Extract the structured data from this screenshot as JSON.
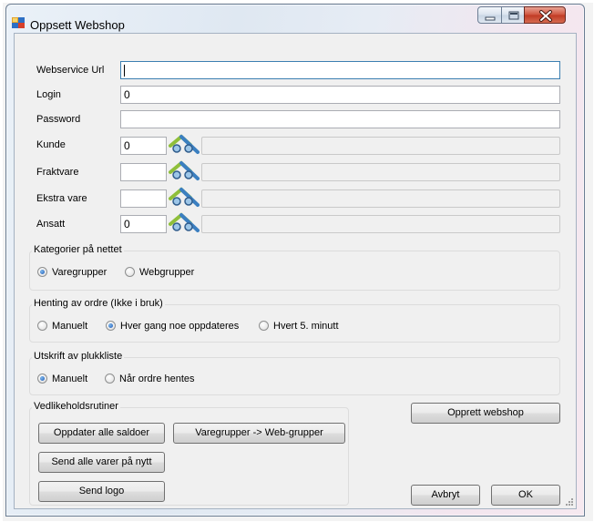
{
  "window": {
    "title": "Oppsett Webshop"
  },
  "fields": {
    "webservice_url": {
      "label": "Webservice Url",
      "value": ""
    },
    "login": {
      "label": "Login",
      "value": "0"
    },
    "password": {
      "label": "Password",
      "value": ""
    },
    "kunde": {
      "label": "Kunde",
      "value": "0",
      "description": ""
    },
    "fraktvare": {
      "label": "Fraktvare",
      "value": "",
      "description": ""
    },
    "ekstra_vare": {
      "label": "Ekstra vare",
      "value": "",
      "description": ""
    },
    "ansatt": {
      "label": "Ansatt",
      "value": "0",
      "description": ""
    }
  },
  "kategorier": {
    "title": "Kategorier på nettet",
    "options": [
      "Varegrupper",
      "Webgrupper"
    ],
    "selected": "Varegrupper"
  },
  "henting": {
    "title": "Henting av ordre (Ikke i bruk)",
    "options": [
      "Manuelt",
      "Hver gang noe oppdateres",
      "Hvert 5. minutt"
    ],
    "selected": "Hver gang noe oppdateres"
  },
  "utskrift": {
    "title": "Utskrift av plukkliste",
    "options": [
      "Manuelt",
      "Når ordre hentes"
    ],
    "selected": "Manuelt"
  },
  "vedlikehold": {
    "title": "Vedlikeholdsrutiner",
    "buttons": {
      "update_balances": "Oppdater alle saldoer",
      "group_mapping": "Varegrupper -> Web-grupper",
      "resend_items": "Send alle varer på nytt",
      "send_logo": "Send logo"
    }
  },
  "actions": {
    "create_webshop": "Opprett webshop",
    "cancel": "Avbryt",
    "ok": "OK"
  },
  "icons": {
    "window": "app-window-icon",
    "lookup": "binoculars-lookup-icon",
    "minimize": "minimize-icon",
    "maximize": "maximize-icon",
    "close": "close-icon",
    "resize": "resize-grip-icon"
  }
}
